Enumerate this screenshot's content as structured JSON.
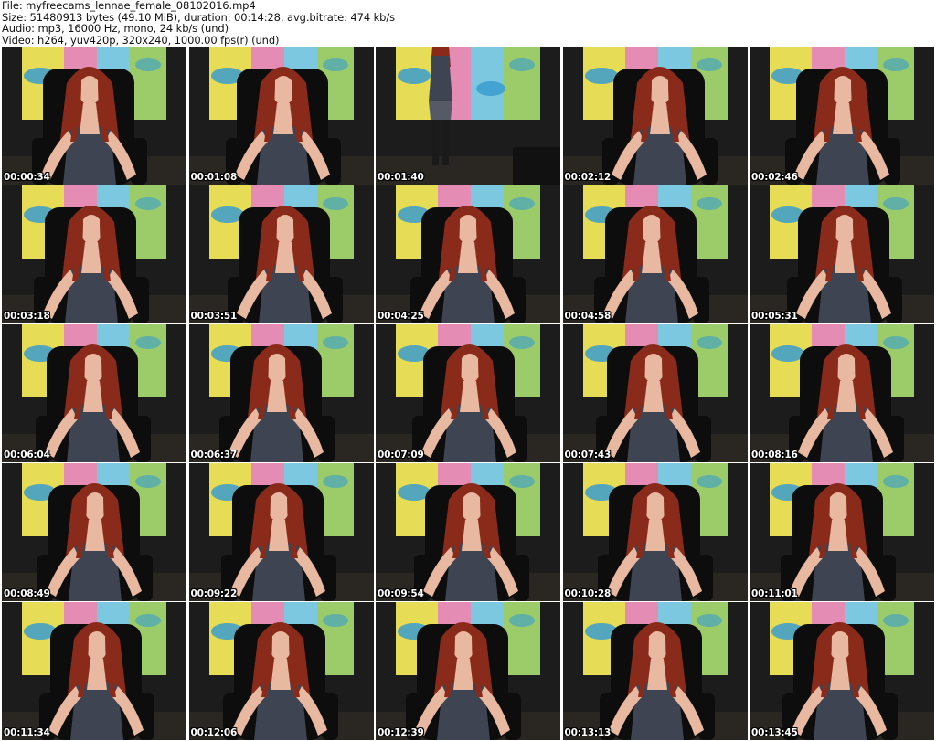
{
  "header": {
    "file_line": "File: myfreecams_lennae_female_08102016.mp4",
    "size_line": "Size: 51480913 bytes (49.10 MiB), duration: 00:14:28, avg.bitrate: 474 kb/s",
    "audio_line": "Audio: mp3, 16000 Hz, mono, 24 kb/s (und)",
    "video_line": "Video: h264, yuv420p, 320x240, 1000.00 fps(r) (und)"
  },
  "frames": [
    {
      "time": "00:00:34",
      "pose": "seated"
    },
    {
      "time": "00:01:08",
      "pose": "seated"
    },
    {
      "time": "00:01:40",
      "pose": "standing"
    },
    {
      "time": "00:02:12",
      "pose": "seated"
    },
    {
      "time": "00:02:46",
      "pose": "seated"
    },
    {
      "time": "00:03:18",
      "pose": "seated"
    },
    {
      "time": "00:03:51",
      "pose": "seated"
    },
    {
      "time": "00:04:25",
      "pose": "seated"
    },
    {
      "time": "00:04:58",
      "pose": "seated"
    },
    {
      "time": "00:05:31",
      "pose": "seated"
    },
    {
      "time": "00:06:04",
      "pose": "seated"
    },
    {
      "time": "00:06:37",
      "pose": "seated"
    },
    {
      "time": "00:07:09",
      "pose": "seated"
    },
    {
      "time": "00:07:43",
      "pose": "seated"
    },
    {
      "time": "00:08:16",
      "pose": "seated"
    },
    {
      "time": "00:08:49",
      "pose": "seated"
    },
    {
      "time": "00:09:22",
      "pose": "seated"
    },
    {
      "time": "00:09:54",
      "pose": "seated"
    },
    {
      "time": "00:10:28",
      "pose": "seated"
    },
    {
      "time": "00:11:01",
      "pose": "seated"
    },
    {
      "time": "00:11:34",
      "pose": "seated"
    },
    {
      "time": "00:12:06",
      "pose": "seated"
    },
    {
      "time": "00:12:39",
      "pose": "seated"
    },
    {
      "time": "00:13:13",
      "pose": "seated"
    },
    {
      "time": "00:13:45",
      "pose": "seated"
    }
  ],
  "colors": {
    "background_wall": "#1c1c1c",
    "panel_yellow": "#e6dc55",
    "panel_pink": "#e48cb4",
    "panel_blue": "#7cc8e0",
    "panel_green": "#9ccc6a",
    "lips_blue": "#3a9ccf",
    "chair": "#0d0d0d",
    "hair": "#8a2a1a",
    "skin": "#e8b8a0",
    "dress": "#3e4452",
    "timestamp_text": "#ffffff"
  }
}
